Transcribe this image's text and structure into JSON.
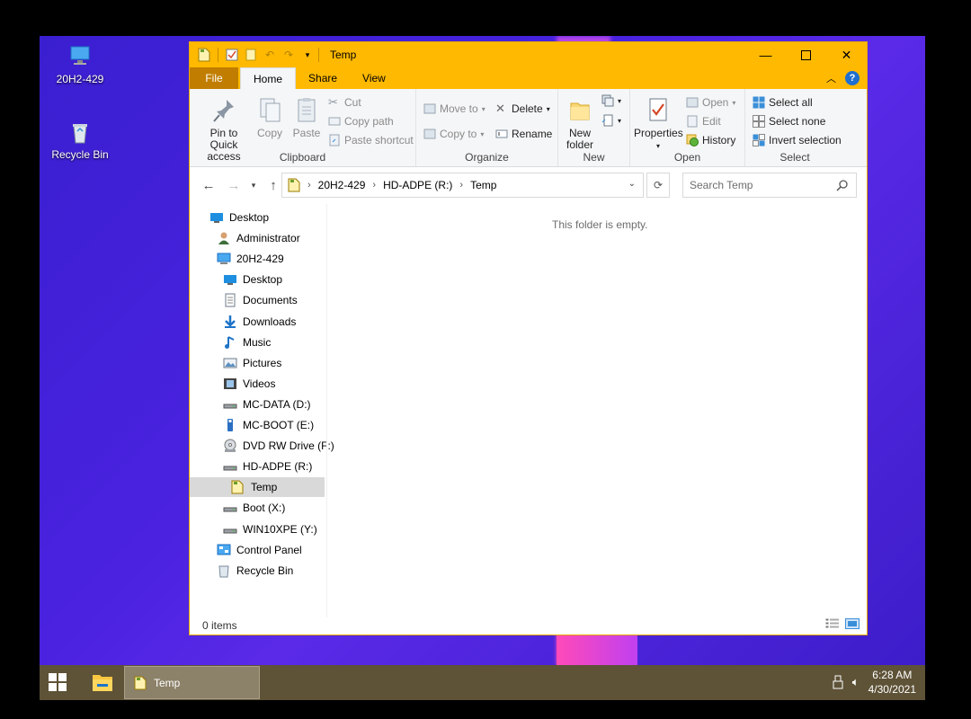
{
  "desktop": {
    "icons": [
      {
        "label": "20H2-429",
        "icon": "computer-icon"
      },
      {
        "label": "Recycle Bin",
        "icon": "recycle-bin-icon"
      }
    ]
  },
  "window": {
    "title": "Temp",
    "tabs": {
      "file": "File",
      "home": "Home",
      "share": "Share",
      "view": "View"
    },
    "help": "?"
  },
  "ribbon": {
    "clipboard": {
      "label": "Clipboard",
      "pin": "Pin to Quick access",
      "copy": "Copy",
      "paste": "Paste",
      "cut": "Cut",
      "copy_path": "Copy path",
      "paste_shortcut": "Paste shortcut"
    },
    "organize": {
      "label": "Organize",
      "move_to": "Move to",
      "copy_to": "Copy to",
      "delete": "Delete",
      "rename": "Rename"
    },
    "new": {
      "label": "New",
      "new_folder": "New folder"
    },
    "open": {
      "label": "Open",
      "properties": "Properties",
      "open": "Open",
      "edit": "Edit",
      "history": "History"
    },
    "select": {
      "label": "Select",
      "select_all": "Select all",
      "select_none": "Select none",
      "invert": "Invert selection"
    }
  },
  "address": {
    "crumbs": [
      "20H2-429",
      "HD-ADPE (R:)",
      "Temp"
    ],
    "search_placeholder": "Search Temp"
  },
  "nav": [
    {
      "label": "Desktop",
      "icon": "desktop-icon",
      "indent": 0
    },
    {
      "label": "Administrator",
      "icon": "user-icon",
      "indent": 1
    },
    {
      "label": "20H2-429",
      "icon": "computer-icon",
      "indent": 1
    },
    {
      "label": "Desktop",
      "icon": "desktop-icon",
      "indent": 2
    },
    {
      "label": "Documents",
      "icon": "documents-icon",
      "indent": 2
    },
    {
      "label": "Downloads",
      "icon": "downloads-icon",
      "indent": 2
    },
    {
      "label": "Music",
      "icon": "music-icon",
      "indent": 2
    },
    {
      "label": "Pictures",
      "icon": "pictures-icon",
      "indent": 2
    },
    {
      "label": "Videos",
      "icon": "videos-icon",
      "indent": 2
    },
    {
      "label": "MC-DATA (D:)",
      "icon": "drive-icon",
      "indent": 2
    },
    {
      "label": "MC-BOOT (E:)",
      "icon": "usb-drive-icon",
      "indent": 2
    },
    {
      "label": "DVD RW Drive (F:)",
      "icon": "dvd-icon",
      "indent": 2
    },
    {
      "label": "HD-ADPE (R:)",
      "icon": "drive-icon",
      "indent": 2
    },
    {
      "label": "Temp",
      "icon": "folder-icon",
      "indent": 3,
      "selected": true
    },
    {
      "label": "Boot (X:)",
      "icon": "drive-icon",
      "indent": 2
    },
    {
      "label": "WIN10XPE (Y:)",
      "icon": "drive-icon",
      "indent": 2
    },
    {
      "label": "Control Panel",
      "icon": "control-panel-icon",
      "indent": 1
    },
    {
      "label": "Recycle Bin",
      "icon": "recycle-bin-icon",
      "indent": 1
    }
  ],
  "content": {
    "empty_text": "This folder is empty."
  },
  "status": {
    "items": "0 items"
  },
  "taskbar": {
    "task_label": "Temp",
    "time": "6:28 AM",
    "date": "4/30/2021"
  }
}
